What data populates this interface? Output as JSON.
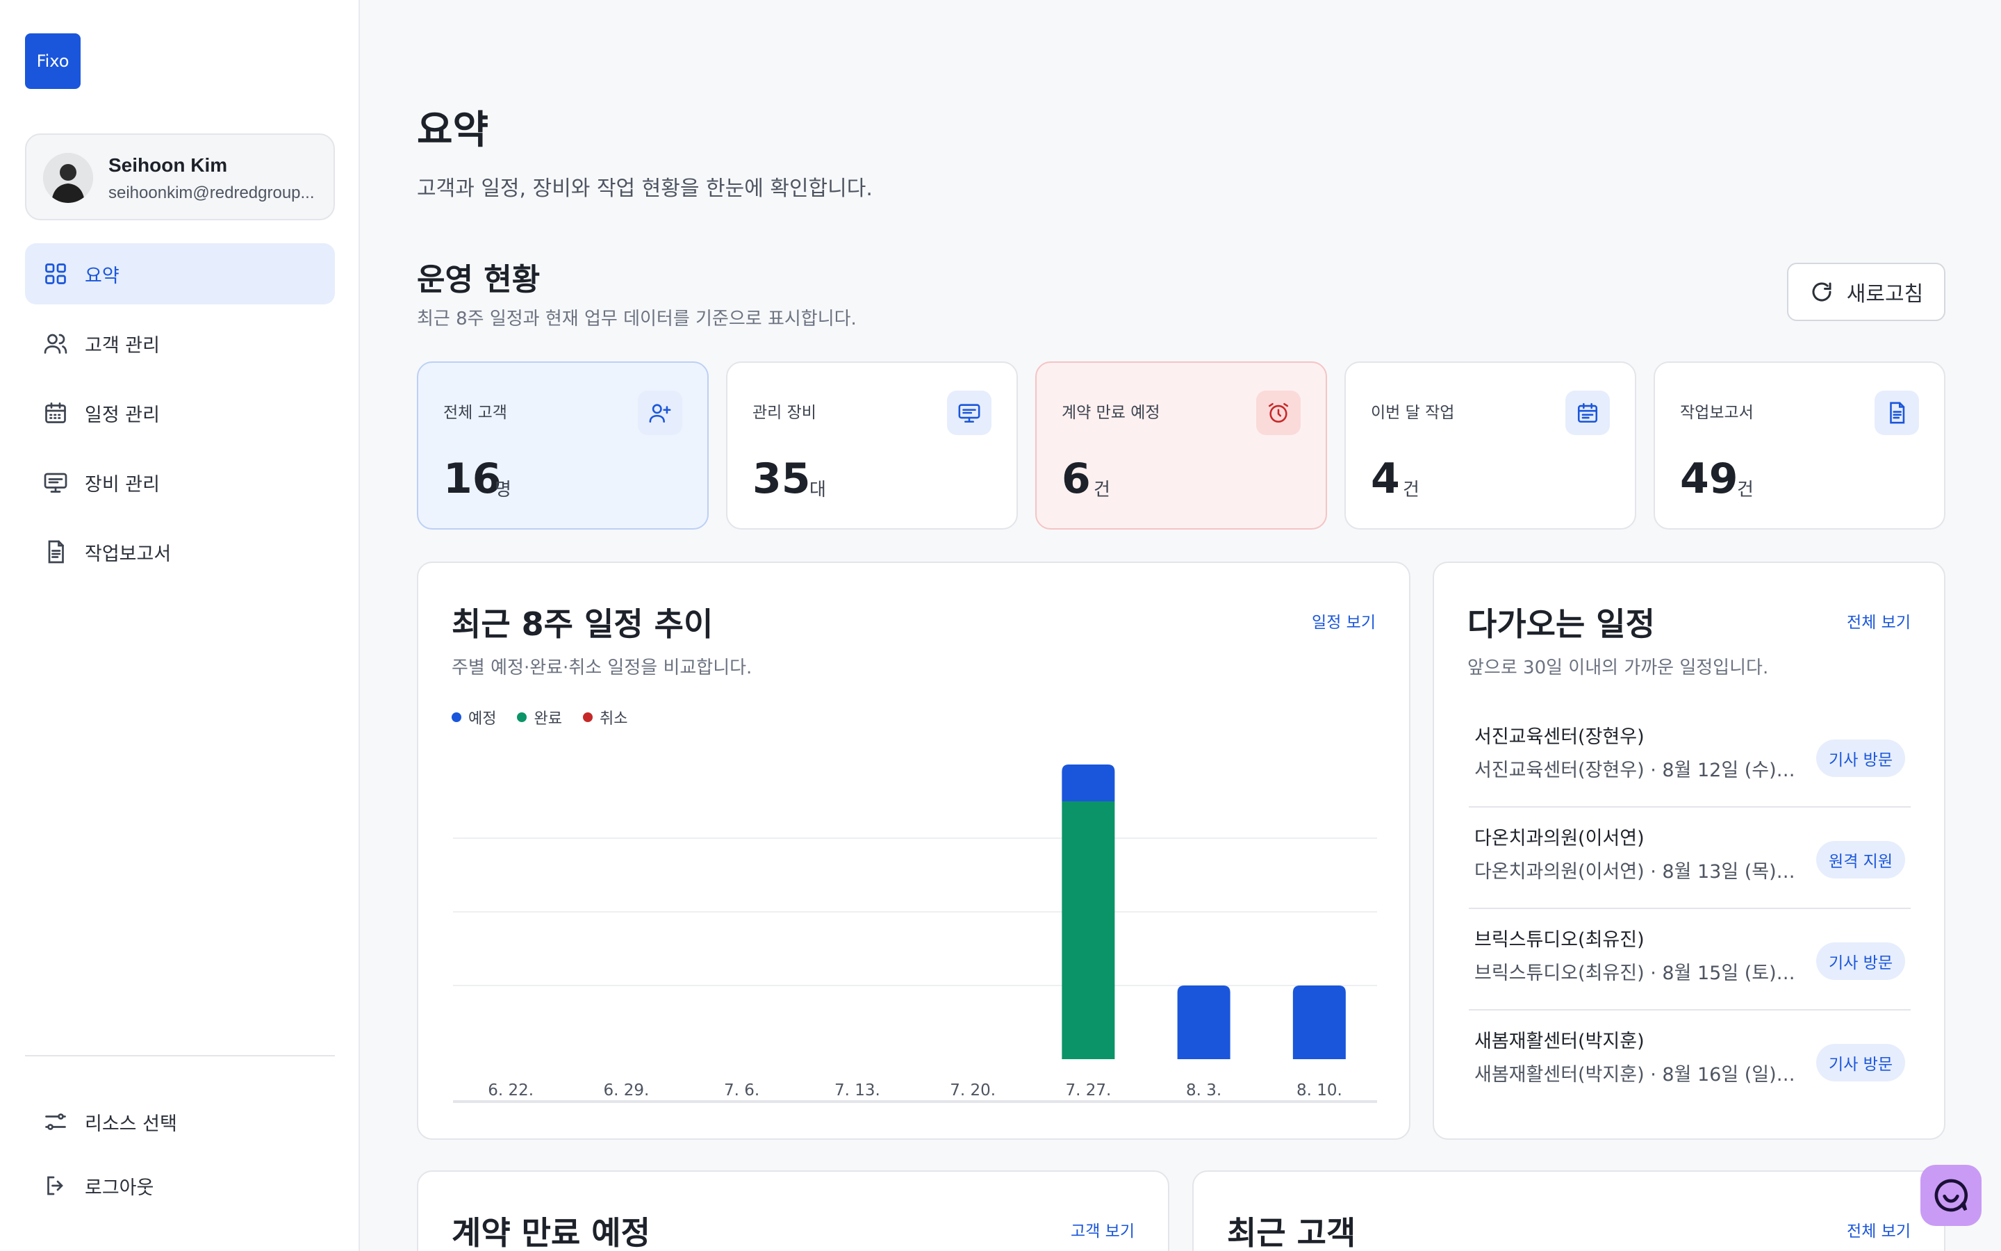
{
  "sidebar": {
    "logo": "Fixo",
    "user": {
      "name": "Seihoon Kim",
      "email": "seihoonkim@redredgroup..."
    },
    "nav": [
      {
        "label": "요약",
        "icon": "grid-icon",
        "active": true
      },
      {
        "label": "고객 관리",
        "icon": "users-icon"
      },
      {
        "label": "일정 관리",
        "icon": "calendar-icon"
      },
      {
        "label": "장비 관리",
        "icon": "monitor-icon"
      },
      {
        "label": "작업보고서",
        "icon": "document-icon"
      }
    ],
    "bottom": [
      {
        "label": "리소스 선택",
        "icon": "sliders-icon"
      },
      {
        "label": "로그아웃",
        "icon": "logout-icon"
      }
    ]
  },
  "header": {
    "title": "요약",
    "subtitle": "고객과 일정, 장비와 작업 현황을 한눈에 확인합니다."
  },
  "operations": {
    "title": "운영 현황",
    "subtitle": "최근 8주 일정과 현재 업무 데이터를 기준으로 표시합니다.",
    "refresh_label": "새로고침",
    "stats": [
      {
        "label": "전체 고객",
        "value": "16",
        "unit": "명",
        "icon": "user-plus-icon",
        "style": "blue"
      },
      {
        "label": "관리 장비",
        "value": "35",
        "unit": "대",
        "icon": "monitor-icon",
        "style": "default"
      },
      {
        "label": "계약 만료 예정",
        "value": "6",
        "unit": "건",
        "icon": "alarm-clock-icon",
        "style": "red"
      },
      {
        "label": "이번 달 작업",
        "value": "4",
        "unit": "건",
        "icon": "calendar-icon",
        "style": "default"
      },
      {
        "label": "작업보고서",
        "value": "49",
        "unit": "건",
        "icon": "document-icon",
        "style": "default"
      }
    ]
  },
  "trend": {
    "title": "최근 8주 일정 추이",
    "subtitle": "주별 예정·완료·취소 일정을 비교합니다.",
    "link": "일정 보기"
  },
  "chart_data": {
    "type": "bar",
    "stacked": true,
    "categories": [
      "6. 22.",
      "6. 29.",
      "7. 6.",
      "7. 13.",
      "7. 20.",
      "7. 27.",
      "8. 3.",
      "8. 10."
    ],
    "series": [
      {
        "name": "예정",
        "color": "#1a56db",
        "values": [
          0,
          0,
          0,
          0,
          0,
          1,
          2,
          2
        ]
      },
      {
        "name": "완료",
        "color": "#0b9467",
        "values": [
          0,
          0,
          0,
          0,
          0,
          7,
          0,
          0
        ]
      },
      {
        "name": "취소",
        "color": "#c62828",
        "values": [
          0,
          0,
          0,
          0,
          0,
          0,
          0,
          0
        ]
      }
    ],
    "ylim": [
      0,
      8
    ],
    "grid": true,
    "legend": "top-left"
  },
  "upcoming": {
    "title": "다가오는 일정",
    "subtitle": "앞으로 30일 이내의 가까운 일정입니다.",
    "link": "전체 보기",
    "items": [
      {
        "name": "서진교육센터(장현우)",
        "detail": "서진교육센터(장현우) · 8월 12일 (수) 오...",
        "badge": "기사 방문"
      },
      {
        "name": "다온치과의원(이서연)",
        "detail": "다온치과의원(이서연) · 8월 13일 (목) 오...",
        "badge": "원격 지원"
      },
      {
        "name": "브릭스튜디오(최유진)",
        "detail": "브릭스튜디오(최유진) · 8월 15일 (토) 오...",
        "badge": "기사 방문"
      },
      {
        "name": "새봄재활센터(박지훈)",
        "detail": "새봄재활센터(박지훈) · 8월 16일 (일) 오...",
        "badge": "기사 방문"
      }
    ]
  },
  "contracts": {
    "title": "계약 만료 예정",
    "link": "고객 보기"
  },
  "recent_customers": {
    "title": "최근 고객",
    "link": "전체 보기"
  },
  "colors": {
    "accent": "#1a56db",
    "success": "#0b9467",
    "danger": "#c62828"
  }
}
